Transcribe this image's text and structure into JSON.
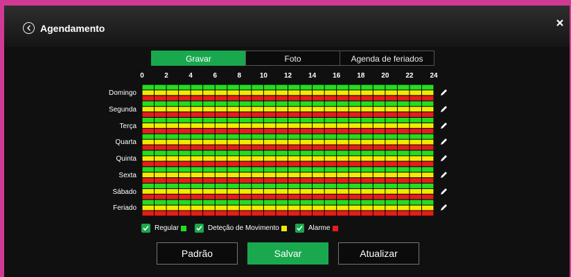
{
  "dialog": {
    "title": "Agendamento",
    "close_label": "×"
  },
  "tabs": [
    {
      "label": "Gravar",
      "active": true
    },
    {
      "label": "Foto",
      "active": false
    },
    {
      "label": "Agenda de feriados",
      "active": false
    }
  ],
  "hour_ticks": [
    "0",
    "2",
    "4",
    "6",
    "8",
    "10",
    "12",
    "14",
    "16",
    "18",
    "20",
    "22",
    "24"
  ],
  "days": [
    "Domingo",
    "Segunda",
    "Terça",
    "Quarta",
    "Quinta",
    "Sexta",
    "Sábado",
    "Feriado"
  ],
  "tracks": [
    {
      "name": "Regular",
      "color": "#22dd22"
    },
    {
      "name": "Deteção de Movimento",
      "color": "#f2ea00"
    },
    {
      "name": "Alarme",
      "color": "#e81c1c"
    }
  ],
  "legend": {
    "regular_label": "Regular",
    "motion_label": "Deteção de Movimento",
    "alarm_label": "Alarme"
  },
  "buttons": {
    "default_label": "Padrão",
    "save_label": "Salvar",
    "refresh_label": "Atualizar"
  },
  "colors": {
    "accent": "#1aa84f",
    "frame": "#d13a93"
  }
}
